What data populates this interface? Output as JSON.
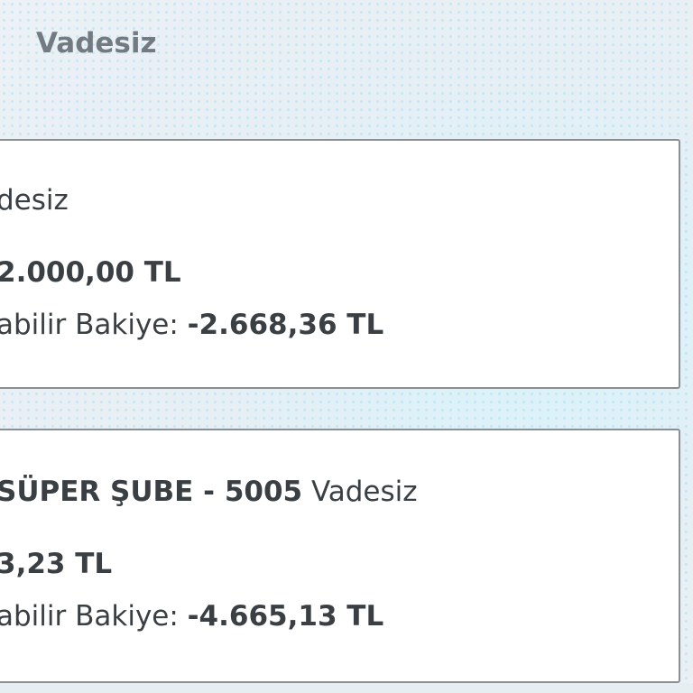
{
  "section": {
    "title": "Vadesiz"
  },
  "accounts": [
    {
      "name_line": "desiz",
      "name_suffix": "",
      "balance": "2.000,00 TL",
      "available_label": "abilir Bakiye:",
      "available_value": "-2.668,36 TL"
    },
    {
      "name_line": " SÜPER ŞUBE - 5005",
      "name_suffix": "Vadesiz",
      "balance": "3,23 TL",
      "available_label": "abilir Bakiye:",
      "available_value": "-4.665,13 TL"
    }
  ]
}
